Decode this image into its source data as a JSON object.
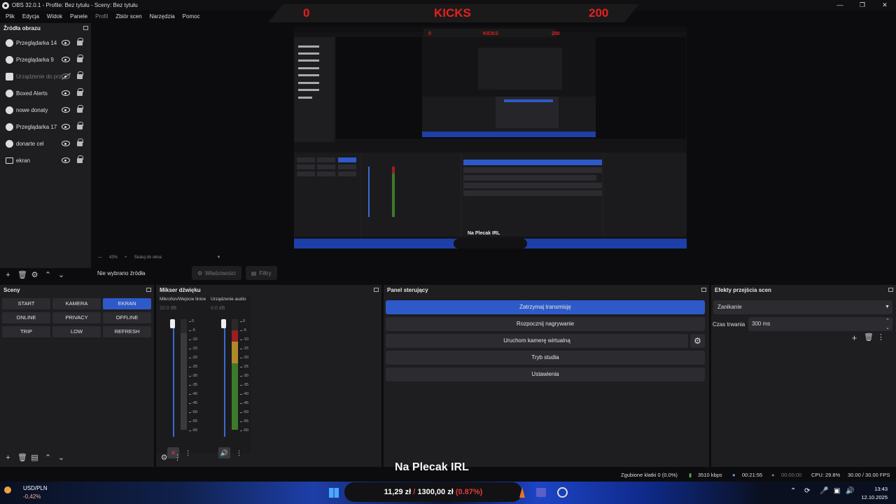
{
  "window": {
    "title": "OBS 32.0.1 - Profile: Bez tytułu - Sceny: Bez tytułu"
  },
  "scoreboard": {
    "left": "0",
    "center": "KICKS",
    "right": "200"
  },
  "menu": [
    "Plik",
    "Edycja",
    "Widok",
    "Panele",
    "Profil",
    "Zbiór scen",
    "Narzędzia",
    "Pomoc"
  ],
  "sources": {
    "title": "Źródła obrazu",
    "items": [
      {
        "label": "Przeglądarka 14",
        "icon": "globe-icon",
        "visible": true
      },
      {
        "label": "Przeglądarka 9",
        "icon": "globe-icon",
        "visible": true
      },
      {
        "label": "Urządzenie do prz",
        "icon": "camera-icon",
        "visible": false
      },
      {
        "label": "Boxed Alerts",
        "icon": "globe-icon",
        "visible": true
      },
      {
        "label": "nowe donaty",
        "icon": "globe-icon",
        "visible": true
      },
      {
        "label": "Przeglądarka 17",
        "icon": "globe-icon",
        "visible": true
      },
      {
        "label": "donarte cel",
        "icon": "globe-icon",
        "visible": true
      },
      {
        "label": "ekran",
        "icon": "monitor-icon",
        "visible": true
      }
    ]
  },
  "zoom": {
    "percent": "43%",
    "mode": "Skaluj do okna"
  },
  "propsbar": {
    "no_selection": "Nie wybrano źródła",
    "properties": "Właściwości",
    "filters": "Filtry"
  },
  "scenes": {
    "title": "Sceny",
    "buttons": [
      "START",
      "KAMERA",
      "EKRAN",
      "ONLINE",
      "PRIVACY",
      "OFFLINE",
      "TRIP",
      "LOW",
      "REFRESH"
    ],
    "active": "EKRAN"
  },
  "mixer": {
    "title": "Mikser dźwięku",
    "channels": [
      {
        "name": "Mikrofon/Wejście liniowe",
        "db": "10.0 dB",
        "level": 0.0,
        "muted": true
      },
      {
        "name": "Urządzenie audio",
        "db": "0.0 dB",
        "level": 0.9,
        "muted": false
      }
    ],
    "scale": [
      "0",
      "-5",
      "-10",
      "-15",
      "-20",
      "-25",
      "-30",
      "-35",
      "-40",
      "-45",
      "-50",
      "-55",
      "-60"
    ]
  },
  "controls": {
    "title": "Panel sterujący",
    "stop_stream": "Zatrzymaj transmisję",
    "start_record": "Rozpocznij nagrywanie",
    "virtual_cam": "Uruchom kamerę wirtualną",
    "studio_mode": "Tryb studia",
    "settings": "Ustawienia"
  },
  "transitions": {
    "title": "Efekty przejścia scen",
    "selected": "Zanikanie",
    "duration_label": "Czas trwania",
    "duration_value": "300 ms"
  },
  "overlay_label": "Na Plecak IRL",
  "status": {
    "dropped": "Zgubione klatki 0 (0.0%)",
    "bitrate": "3510 kbps",
    "stream_time": "00:21:55",
    "rec_time": "00:00:00",
    "cpu": "CPU: 29.8%",
    "fps": "30.00 / 30.00 FPS"
  },
  "taskbar": {
    "pair": "USD/PLN",
    "change": "-0,42%",
    "ticker_value": "11,29 zł",
    "ticker_sep": "/",
    "ticker_target": "1300,00 zł",
    "ticker_pct": "(0.87%)",
    "time": "13:43",
    "date": "12.10.2025"
  },
  "nested": {
    "score_left": "0",
    "score_center": "KICKS",
    "score_right": "200",
    "label": "Na Plecak IRL"
  },
  "colors": {
    "accent": "#2d5ac8",
    "red": "#e62020",
    "panel": "#1e1e21"
  }
}
